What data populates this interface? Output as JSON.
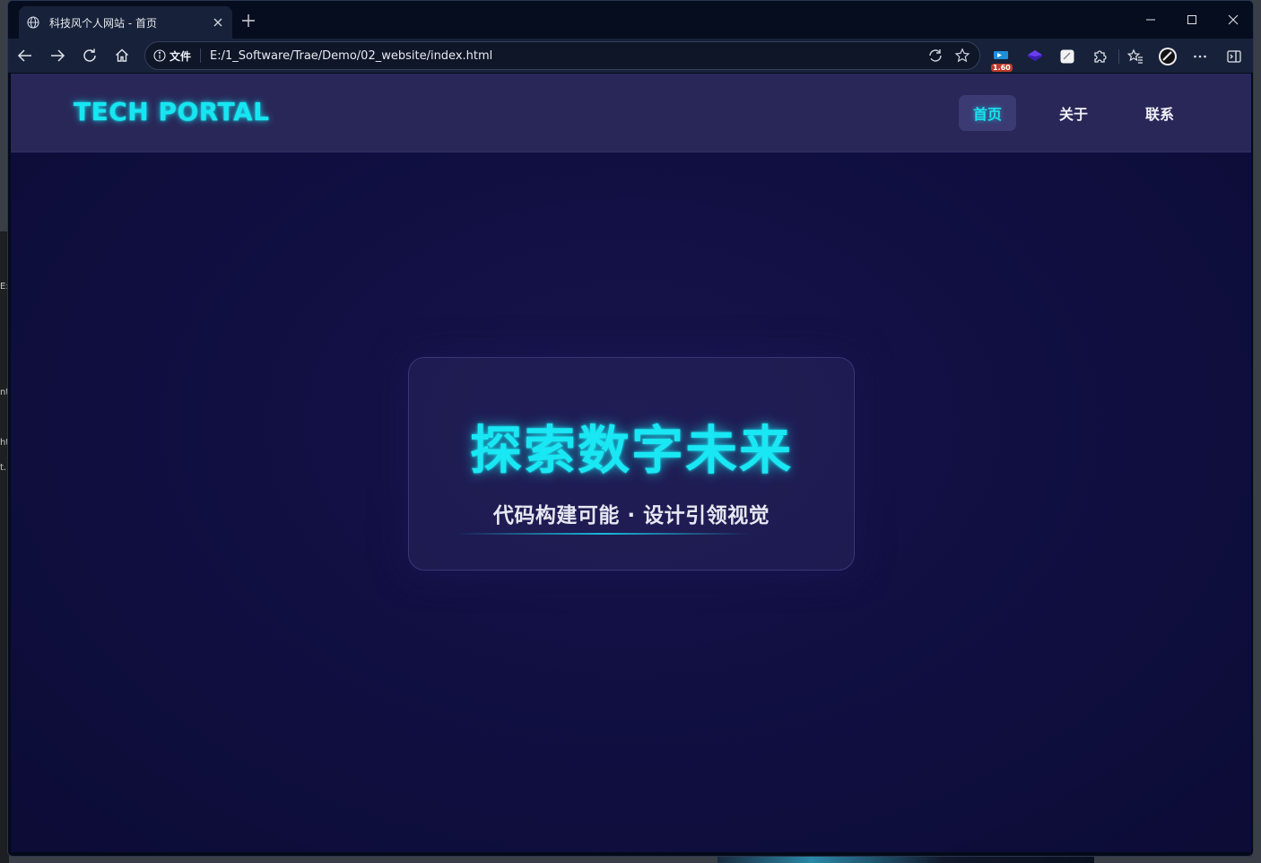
{
  "browser": {
    "tab": {
      "title": "科技风个人网站 - 首页",
      "favicon": "globe-icon",
      "close": "×"
    },
    "new_tab": "+",
    "address": {
      "scheme_label": "文件",
      "url": "E:/1_Software/Trae/Demo/02_website/index.html"
    },
    "extensions": {
      "badge": "1.60"
    }
  },
  "background_window": {
    "glyphs": [
      "E:",
      "nt",
      "ht",
      "t."
    ]
  },
  "site": {
    "logo": "TECH PORTAL",
    "nav": [
      {
        "label": "首页",
        "active": true
      },
      {
        "label": "关于",
        "active": false
      },
      {
        "label": "联系",
        "active": false
      }
    ],
    "hero": {
      "title": "探索数字未来",
      "subtitle": "代码构建可能 · 设计引领视觉"
    }
  },
  "colors": {
    "accent": "#19e8f4",
    "header_bg": "#292758",
    "page_bg": "#110f42",
    "browser_chrome": "#17223a"
  }
}
